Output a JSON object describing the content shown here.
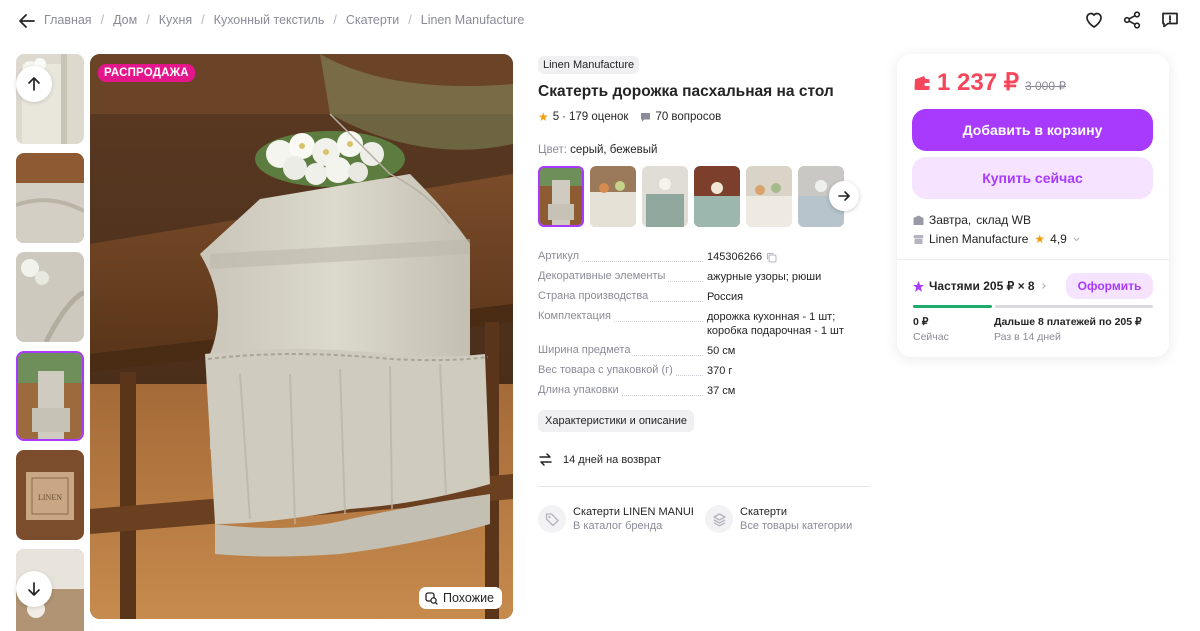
{
  "breadcrumb": [
    "Главная",
    "Дом",
    "Кухня",
    "Кухонный текстиль",
    "Скатерти",
    "Linen Manufacture"
  ],
  "gallery": {
    "sale_badge": "РАСПРОДАЖА",
    "similar_label": "Похожие",
    "selected_thumb": 4
  },
  "product": {
    "brand": "Linen Manufacture",
    "title": "Скатерть дорожка пасхальная на стол",
    "rating": "5",
    "reviews": "179 оценок",
    "questions": "70 вопросов",
    "color_label": "Цвет:",
    "color_value": "серый, бежевый"
  },
  "specs": [
    {
      "key": "Артикул",
      "value": "145306266"
    },
    {
      "key": "Декоративные элементы",
      "value": "ажурные узоры; рюши"
    },
    {
      "key": "Страна производства",
      "value": "Россия"
    },
    {
      "key": "Комплектация",
      "value": "дорожка кухонная - 1 шт;\nкоробка подарочная - 1 шт"
    },
    {
      "key": "Ширина предмета",
      "value": "50 см"
    },
    {
      "key": "Вес товара с упаковкой (г)",
      "value": "370 г"
    },
    {
      "key": "Длина упаковки",
      "value": "37 см"
    }
  ],
  "characteristics_button": "Характеристики и описание",
  "returns_text": "14 дней на возврат",
  "catalog_links": [
    {
      "title": "Скатерти LINEN MANUFACTURE",
      "subtitle": "В каталог бренда"
    },
    {
      "title": "Скатерти",
      "subtitle": "Все товары категории"
    }
  ],
  "buy_card": {
    "price": "1 237 ₽",
    "old_price": "3 000 ₽",
    "add_to_cart": "Добавить в корзину",
    "buy_now": "Купить сейчас",
    "delivery": "Завтра,",
    "warehouse": "склад WB",
    "seller": "Linen Manufacture",
    "seller_rating": "4,9",
    "installment": "Частями 205 ₽ × 8",
    "installment_button": "Оформить",
    "pay_now_amount": "0 ₽",
    "pay_now_label": "Сейчас",
    "pay_later_amount": "Дальше 8 платежей по 205 ₽",
    "pay_later_label": "Раз в 14 дней",
    "installment_progress": 0.33
  },
  "colors": {
    "accent": "#a73afd",
    "accent_light": "#f6e3ff",
    "price": "#f5475c",
    "sale": "#e4168b",
    "progress": "#1fab6e"
  }
}
